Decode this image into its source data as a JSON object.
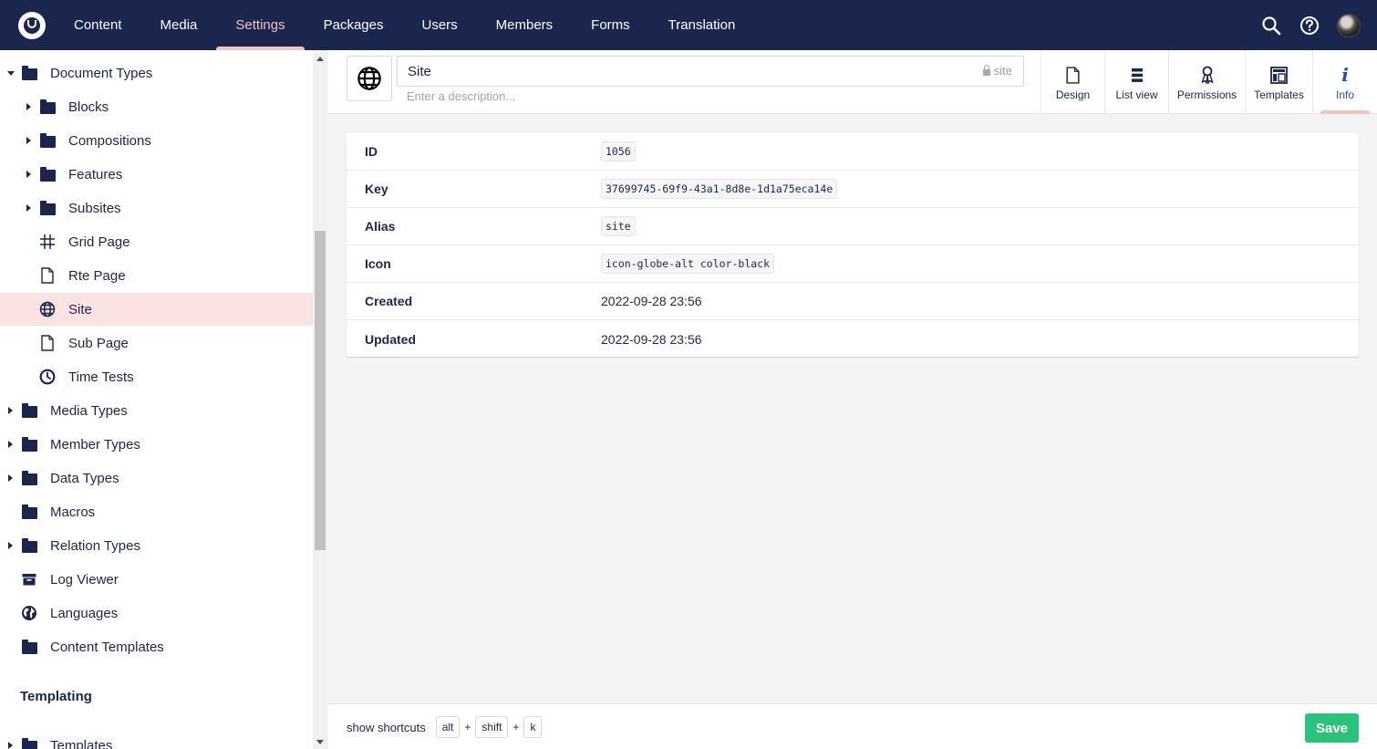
{
  "topnav": {
    "sections": [
      "Content",
      "Media",
      "Settings",
      "Packages",
      "Users",
      "Members",
      "Forms",
      "Translation"
    ],
    "active_section": "Settings",
    "icons": [
      "search-icon",
      "help-icon",
      "avatar"
    ]
  },
  "sidebar": {
    "items": [
      {
        "label": "Document Types",
        "icon": "folder-icon",
        "expanded": true
      },
      {
        "label": "Blocks",
        "icon": "folder-icon",
        "expandable": true
      },
      {
        "label": "Compositions",
        "icon": "folder-icon",
        "expandable": true
      },
      {
        "label": "Features",
        "icon": "folder-icon",
        "expandable": true
      },
      {
        "label": "Subsites",
        "icon": "folder-icon",
        "expandable": true
      },
      {
        "label": "Grid Page",
        "icon": "grid-icon"
      },
      {
        "label": "Rte Page",
        "icon": "document-icon"
      },
      {
        "label": "Site",
        "icon": "globe-icon",
        "selected": true
      },
      {
        "label": "Sub Page",
        "icon": "document-icon"
      },
      {
        "label": "Time Tests",
        "icon": "clock-icon"
      },
      {
        "label": "Media Types",
        "icon": "folder-icon",
        "expandable": true
      },
      {
        "label": "Member Types",
        "icon": "folder-icon",
        "expandable": true
      },
      {
        "label": "Data Types",
        "icon": "folder-icon",
        "expandable": true
      },
      {
        "label": "Macros",
        "icon": "folder-icon"
      },
      {
        "label": "Relation Types",
        "icon": "folder-icon",
        "expandable": true
      },
      {
        "label": "Log Viewer",
        "icon": "box-icon"
      },
      {
        "label": "Languages",
        "icon": "world-icon"
      },
      {
        "label": "Content Templates",
        "icon": "folder-icon"
      }
    ],
    "section_title": "Templating",
    "partial_item": "Templates"
  },
  "editor": {
    "name": "Site",
    "alias": "site",
    "description_placeholder": "Enter a description...",
    "apps": [
      {
        "label": "Design",
        "icon": "document-icon"
      },
      {
        "label": "List view",
        "icon": "list-icon"
      },
      {
        "label": "Permissions",
        "icon": "permissions-icon"
      },
      {
        "label": "Templates",
        "icon": "template-icon"
      },
      {
        "label": "Info",
        "icon": "info-icon",
        "active": true
      }
    ]
  },
  "info": {
    "rows": [
      {
        "label": "ID",
        "value": "1056",
        "code": true
      },
      {
        "label": "Key",
        "value": "37699745-69f9-43a1-8d8e-1d1a75eca14e",
        "code": true
      },
      {
        "label": "Alias",
        "value": "site",
        "code": true
      },
      {
        "label": "Icon",
        "value": "icon-globe-alt color-black",
        "code": true
      },
      {
        "label": "Created",
        "value": "2022-09-28 23:56",
        "code": false
      },
      {
        "label": "Updated",
        "value": "2022-09-28 23:56",
        "code": false
      }
    ]
  },
  "footer": {
    "shortcuts_label": "show shortcuts",
    "keys": [
      "alt",
      "shift",
      "k"
    ],
    "plus": "+",
    "save_label": "Save"
  },
  "colors": {
    "header_bg": "#1b264f",
    "active_accent": "#f5c1bc",
    "selected_row": "#fbe3e1",
    "save_button": "#2bc37c"
  }
}
